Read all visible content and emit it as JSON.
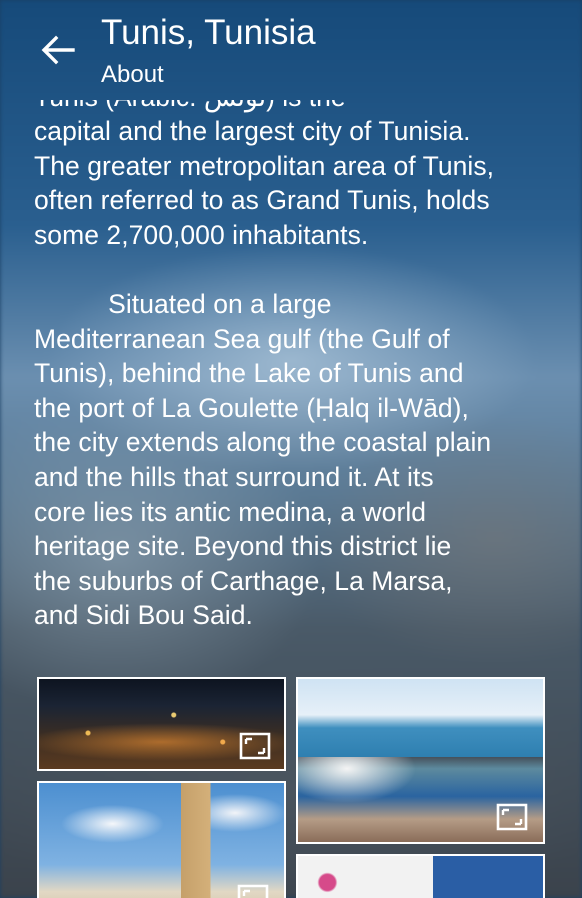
{
  "header": {
    "title": "Tunis, Tunisia",
    "subtitle": "About",
    "back_icon": "arrow-back-icon"
  },
  "about": {
    "cutoff_line": "Tunis (Arabic: تونس) is the",
    "text": "capital and the largest city of Tunisia.\nThe greater metropolitan area of Tunis,\noften referred to as Grand Tunis, holds\nsome 2,700,000 inhabitants.\n\n          Situated on a large\nMediterranean Sea gulf (the Gulf of\nTunis), behind the Lake of Tunis and\nthe port of La Goulette (Ḥalq il-Wād),\nthe city extends along the coastal plain\nand the hills that surround it. At its\ncore lies its antic medina, a world\nheritage site. Beyond this district lie\nthe suburbs of Carthage, La Marsa,\nand Sidi Bou Said."
  },
  "gallery": {
    "expand_icon": "expand-icon",
    "images": [
      {
        "subject": "tunis-night-city-photo"
      },
      {
        "subject": "sidi-bou-said-sea-photo"
      },
      {
        "subject": "zitouna-minaret-photo"
      },
      {
        "subject": "blue-door-photo"
      }
    ]
  },
  "colors": {
    "text": "#ffffff",
    "image_border": "#ffffff"
  }
}
